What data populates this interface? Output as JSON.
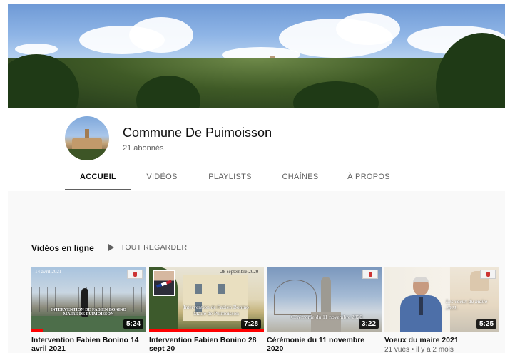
{
  "channel": {
    "name": "Commune De Puimoisson",
    "subscribers": "21 abonnés"
  },
  "tabs": [
    {
      "label": "ACCUEIL",
      "active": true
    },
    {
      "label": "VIDÉOS",
      "active": false
    },
    {
      "label": "PLAYLISTS",
      "active": false
    },
    {
      "label": "CHAÎNES",
      "active": false
    },
    {
      "label": "À PROPOS",
      "active": false
    }
  ],
  "shelf": {
    "title": "Vidéos en ligne",
    "play_all": "TOUT REGARDER"
  },
  "videos": [
    {
      "title": "Intervention Fabien Bonino 14 avril 2021",
      "duration": "5:24",
      "thumb_date": "14 avril 2021",
      "thumb_text": "INTERVENTION DE FABIEN BONINO MAIRE DE PUIMOISSON",
      "watched_fraction": 0.1
    },
    {
      "title": "Intervention Fabien Bonino 28 sept 20",
      "duration": "7:28",
      "thumb_date": "28 septembre 2020",
      "thumb_text": "Intervention de Fabien Bonino Maire de Puimoisson",
      "watched_fraction": 1.0
    },
    {
      "title": "Cérémonie du 11 novembre 2020",
      "duration": "3:22",
      "thumb_text": "Cérémonie du 11 novembre 2020"
    },
    {
      "title": "Voeux du maire 2021",
      "duration": "5:25",
      "meta": "21 vues • il y a 2 mois",
      "thumb_text": "Les voeux du maire 2021."
    }
  ],
  "colors": {
    "accent": "#ff0000",
    "text_primary": "#0f0f0f",
    "text_secondary": "#606060",
    "background": "#f9f9f9"
  },
  "icons": {
    "play_all": "play-icon"
  }
}
